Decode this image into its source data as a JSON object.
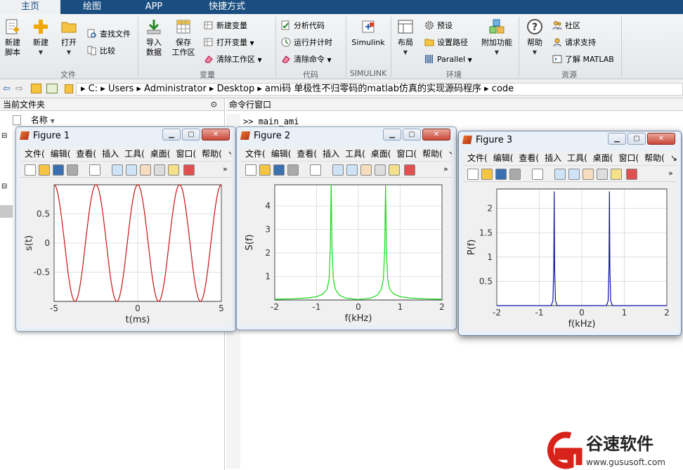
{
  "tabs": [
    {
      "label": "主页",
      "active": true
    },
    {
      "label": "绘图",
      "active": false
    },
    {
      "label": "APP",
      "active": false
    },
    {
      "label": "快捷方式",
      "active": false
    }
  ],
  "toolstrip": {
    "file": {
      "group_label": "文件",
      "new_script": "新建\n脚本",
      "new": "新建",
      "open": "打开",
      "find_files": "查找文件",
      "compare": "比较"
    },
    "variable": {
      "group_label": "变量",
      "import_data": "导入\n数据",
      "save_workspace": "保存\n工作区",
      "new_variable": "新建变量",
      "open_variable": "打开变量",
      "clear_workspace": "清除工作区"
    },
    "code": {
      "group_label": "代码",
      "analyze_code": "分析代码",
      "run_and_time": "运行并计时",
      "clear_commands": "清除命令"
    },
    "simulink": {
      "group_label": "SIMULINK",
      "simulink": "Simulink"
    },
    "environment": {
      "group_label": "环境",
      "layout": "布局",
      "preferences": "预设",
      "set_path": "设置路径",
      "parallel": "Parallel",
      "add_ons": "附加功能"
    },
    "resources": {
      "group_label": "资源",
      "help": "帮助",
      "community": "社区",
      "request_support": "请求支持",
      "learn_matlab": "了解 MATLAB"
    }
  },
  "address": {
    "crumbs": [
      "C:",
      "Users",
      "Administrator",
      "Desktop",
      "ami码 单极性不归零码的matlab仿真的实现源码程序",
      "code"
    ]
  },
  "current_folder": {
    "title": "当前文件夹",
    "column_name": "名称"
  },
  "command_window": {
    "title": "命令行窗口",
    "prompt": ">>",
    "command": "main_ami"
  },
  "figure_menu": [
    "文件(",
    "编辑(",
    "查看(",
    "插入",
    "工具(",
    "桌面(",
    "窗口(",
    "帮助("
  ],
  "figures": [
    {
      "title": "Figure 1",
      "chart_data": {
        "type": "line",
        "title": "",
        "xlabel": "t(ms)",
        "ylabel": "s(t)",
        "xlim": [
          -5,
          5
        ],
        "ylim": [
          -1,
          1
        ],
        "xticks": [
          -5,
          0,
          5
        ],
        "yticks": [
          -0.5,
          0,
          0.5
        ],
        "grid": true,
        "color": "#cc1111",
        "series": [
          {
            "function": "cos",
            "frequency_khz": 0.4,
            "amplitude": 1
          }
        ]
      }
    },
    {
      "title": "Figure 2",
      "chart_data": {
        "type": "line",
        "title": "",
        "xlabel": "f(kHz)",
        "ylabel": "S(f)",
        "xlim": [
          -2,
          2
        ],
        "ylim": [
          0,
          4.9
        ],
        "xticks": [
          -2,
          -1,
          0,
          1,
          2
        ],
        "yticks": [
          1,
          2,
          3,
          4
        ],
        "grid": true,
        "color": "#11dd11",
        "series": [
          {
            "x": [
              -2,
              -1.6,
              -1.2,
              -1.0,
              -0.85,
              -0.75,
              -0.7,
              -0.67,
              -0.65,
              -0.63,
              -0.6,
              -0.55,
              -0.45,
              -0.3,
              0,
              0.3,
              0.45,
              0.55,
              0.6,
              0.63,
              0.65,
              0.67,
              0.7,
              0.75,
              0.85,
              1.0,
              1.2,
              1.6,
              2
            ],
            "y": [
              0.03,
              0.05,
              0.09,
              0.14,
              0.25,
              0.45,
              0.9,
              2.2,
              4.9,
              2.2,
              0.9,
              0.45,
              0.2,
              0.08,
              0.02,
              0.08,
              0.2,
              0.45,
              0.9,
              2.2,
              4.9,
              2.2,
              0.9,
              0.45,
              0.25,
              0.14,
              0.09,
              0.05,
              0.03
            ]
          }
        ]
      }
    },
    {
      "title": "Figure 3",
      "chart_data": {
        "type": "line",
        "title": "",
        "xlabel": "f(kHz)",
        "ylabel": "P(f)",
        "xlim": [
          -2,
          2
        ],
        "ylim": [
          0,
          2.4
        ],
        "xticks": [
          -2,
          -1,
          0,
          1,
          2
        ],
        "yticks": [
          0.5,
          1,
          1.5,
          2
        ],
        "grid": true,
        "color": "#1111aa",
        "series": [
          {
            "x": [
              -2,
              -0.72,
              -0.68,
              -0.66,
              -0.65,
              -0.64,
              -0.62,
              -0.58,
              0.58,
              0.62,
              0.64,
              0.65,
              0.66,
              0.68,
              0.72,
              2
            ],
            "y": [
              0,
              0,
              0.1,
              0.8,
              2.35,
              0.8,
              0.1,
              0,
              0,
              0.1,
              0.8,
              2.35,
              0.8,
              0.1,
              0,
              0
            ]
          }
        ]
      }
    }
  ],
  "watermark": {
    "brand": "谷速软件",
    "url": "www.gususoft.com"
  }
}
